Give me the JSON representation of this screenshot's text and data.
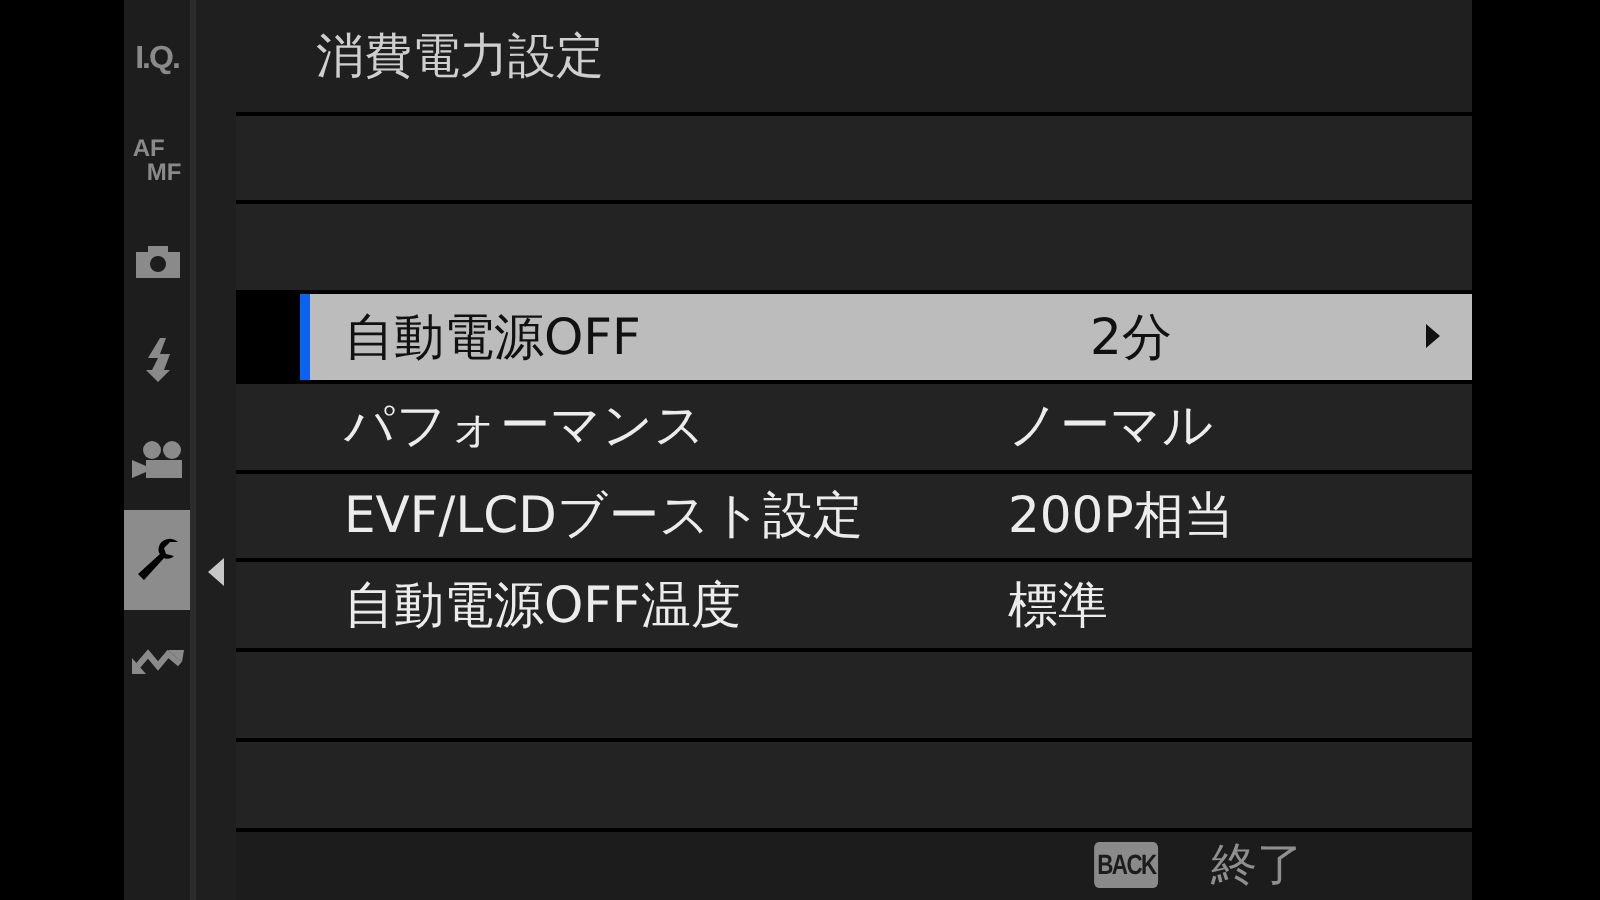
{
  "title": "消費電力設定",
  "sidebar_tabs": [
    {
      "kind": "text",
      "label": "I.Q.",
      "selected": false
    },
    {
      "kind": "stack",
      "label": "AF",
      "label_2": "MF",
      "selected": false
    },
    {
      "kind": "camera",
      "selected": false
    },
    {
      "kind": "flash",
      "selected": false
    },
    {
      "kind": "movie",
      "selected": false
    },
    {
      "kind": "wrench",
      "selected": true
    },
    {
      "kind": "link",
      "selected": false
    }
  ],
  "rows": [
    {
      "kind": "blank"
    },
    {
      "kind": "blank"
    },
    {
      "kind": "setting",
      "label": "自動電源OFF",
      "value": "2分",
      "selected": true
    },
    {
      "kind": "setting",
      "label": "パフォーマンス",
      "value": "ノーマル",
      "selected": false
    },
    {
      "kind": "setting",
      "label": "EVF/LCDブースト設定",
      "value": "200P相当",
      "selected": false
    },
    {
      "kind": "setting",
      "label": "自動電源OFF温度",
      "value": "標準",
      "selected": false
    },
    {
      "kind": "blank"
    },
    {
      "kind": "blank"
    }
  ],
  "footer": {
    "button": "BACK",
    "label": "終了"
  }
}
